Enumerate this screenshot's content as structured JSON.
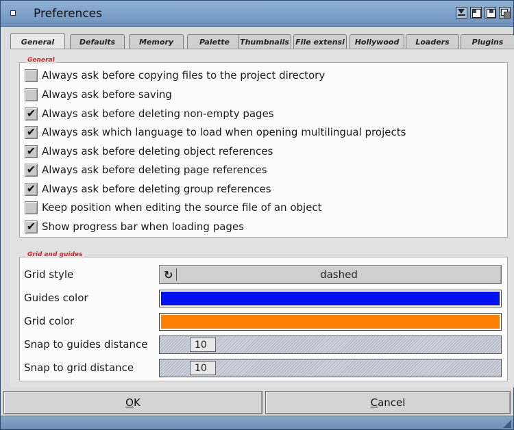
{
  "window": {
    "title": "Preferences",
    "gadgets": [
      "minimize-icon",
      "zoom-icon",
      "iconify-icon",
      "depth-icon"
    ]
  },
  "tabs": [
    {
      "label": "General",
      "active": true
    },
    {
      "label": "Defaults",
      "active": false
    },
    {
      "label": "Memory",
      "active": false
    },
    {
      "label": "Palette",
      "active": false
    },
    {
      "label": "Thumbnails",
      "active": false
    },
    {
      "label": "File extensi",
      "active": false
    },
    {
      "label": "Hollywood",
      "active": false
    },
    {
      "label": "Loaders",
      "active": false
    },
    {
      "label": "Plugins",
      "active": false
    }
  ],
  "general": {
    "group_label": "General",
    "options": [
      {
        "label": "Always ask before copying files to the project directory",
        "checked": false
      },
      {
        "label": "Always ask before saving",
        "checked": false
      },
      {
        "label": "Always ask before deleting non-empty pages",
        "checked": true
      },
      {
        "label": "Always ask which language to load when opening multilingual projects",
        "checked": true
      },
      {
        "label": "Always ask before deleting object references",
        "checked": true
      },
      {
        "label": "Always ask before deleting page references",
        "checked": true
      },
      {
        "label": "Always ask before deleting group references",
        "checked": true
      },
      {
        "label": "Keep position when editing the source file of an object",
        "checked": false
      },
      {
        "label": "Show progress bar when loading pages",
        "checked": true
      }
    ]
  },
  "grid": {
    "group_label": "Grid and guides",
    "grid_style_label": "Grid style",
    "grid_style_value": "dashed",
    "guides_color_label": "Guides color",
    "guides_color": "#0010f0",
    "grid_color_label": "Grid color",
    "grid_color": "#ff8000",
    "snap_guides_label": "Snap to guides distance",
    "snap_guides_value": "10",
    "snap_grid_label": "Snap to grid distance",
    "snap_grid_value": "10"
  },
  "buttons": {
    "ok_label": "OK",
    "cancel_label": "Cancel"
  }
}
